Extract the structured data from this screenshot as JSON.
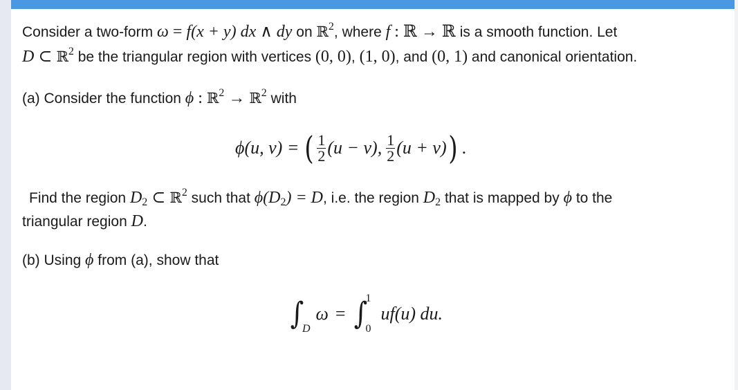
{
  "header": {
    "accent_color": "#4a98e2"
  },
  "problem": {
    "intro": {
      "line1": {
        "t1": "Consider a two-form ",
        "omega": "ω",
        "eq": " = ",
        "f": "f",
        "args": "(x + y) dx ∧ dy",
        "t2": " on ",
        "R": "ℝ",
        "sup": "2",
        "t3": ", where ",
        "f2": "f",
        "map": " : ℝ → ℝ",
        "t4": " is a smooth function. Let"
      },
      "line2": {
        "D": "D",
        "subset": " ⊂ ",
        "R": "ℝ",
        "sup": "2",
        "t1": " be the triangular region with vertices ",
        "v1": "(0, 0)",
        "c1": ", ",
        "v2": "(1, 0)",
        "t2": ", and ",
        "v3": "(0, 1)",
        "t3": " and canonical orientation."
      }
    },
    "part_a": {
      "label": "(a) Consider the function ",
      "phi": "ϕ",
      "colon": " : ",
      "R1": "ℝ",
      "sup1": "2",
      "arrow": " → ",
      "R2": "ℝ",
      "sup2": "2",
      "with": " with",
      "formula": {
        "lhs": "ϕ(u, v) =",
        "frac_num": "1",
        "frac_den": "2",
        "term1": "(u − v),",
        "term2": "(u + v)",
        "end": "."
      },
      "find_line1": {
        "t1": "Find the region ",
        "D": "D",
        "sub": "2",
        "subset": " ⊂ ",
        "R": "ℝ",
        "sup": "2",
        "t2": " such that ",
        "phiD": "ϕ(D",
        "sub2": "2",
        "close": ") = D",
        "t3": ", i.e. the region ",
        "D3": "D",
        "sub3": "2",
        "t4": " that is mapped by ",
        "phi": "ϕ",
        "t5": " to the"
      },
      "find_line2": {
        "t1": "triangular region ",
        "D": "D",
        "end": "."
      }
    },
    "part_b": {
      "label": "(b) Using ",
      "phi": "ϕ",
      "rest": " from (a), show that",
      "formula": {
        "int_sym": "∫",
        "lower1": "D",
        "omega": "ω",
        "eq": "=",
        "upper2": "1",
        "lower2": "0",
        "integrand": "uf(u) du."
      }
    }
  }
}
